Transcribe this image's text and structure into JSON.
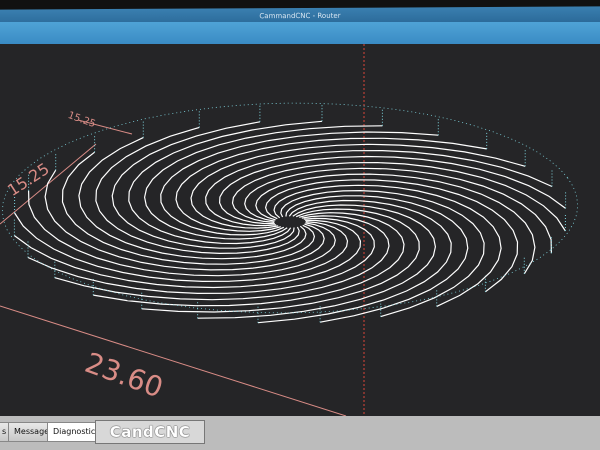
{
  "window": {
    "title": "CammandCNC - Router"
  },
  "viewport": {
    "dimensions": {
      "length_x": "23.60",
      "length_y": "15.25",
      "height_z": "15.25"
    }
  },
  "tabs": [
    {
      "label": "s"
    },
    {
      "label": "Messages"
    },
    {
      "label": "Diagnostics"
    }
  ],
  "brand": {
    "label": "CandCNC"
  },
  "colors": {
    "toolpath": "#ffffff",
    "rapid": "#7fd6e0",
    "dimension": "#d98c86",
    "origin_axis": "#d9453a",
    "background": "#252527"
  }
}
